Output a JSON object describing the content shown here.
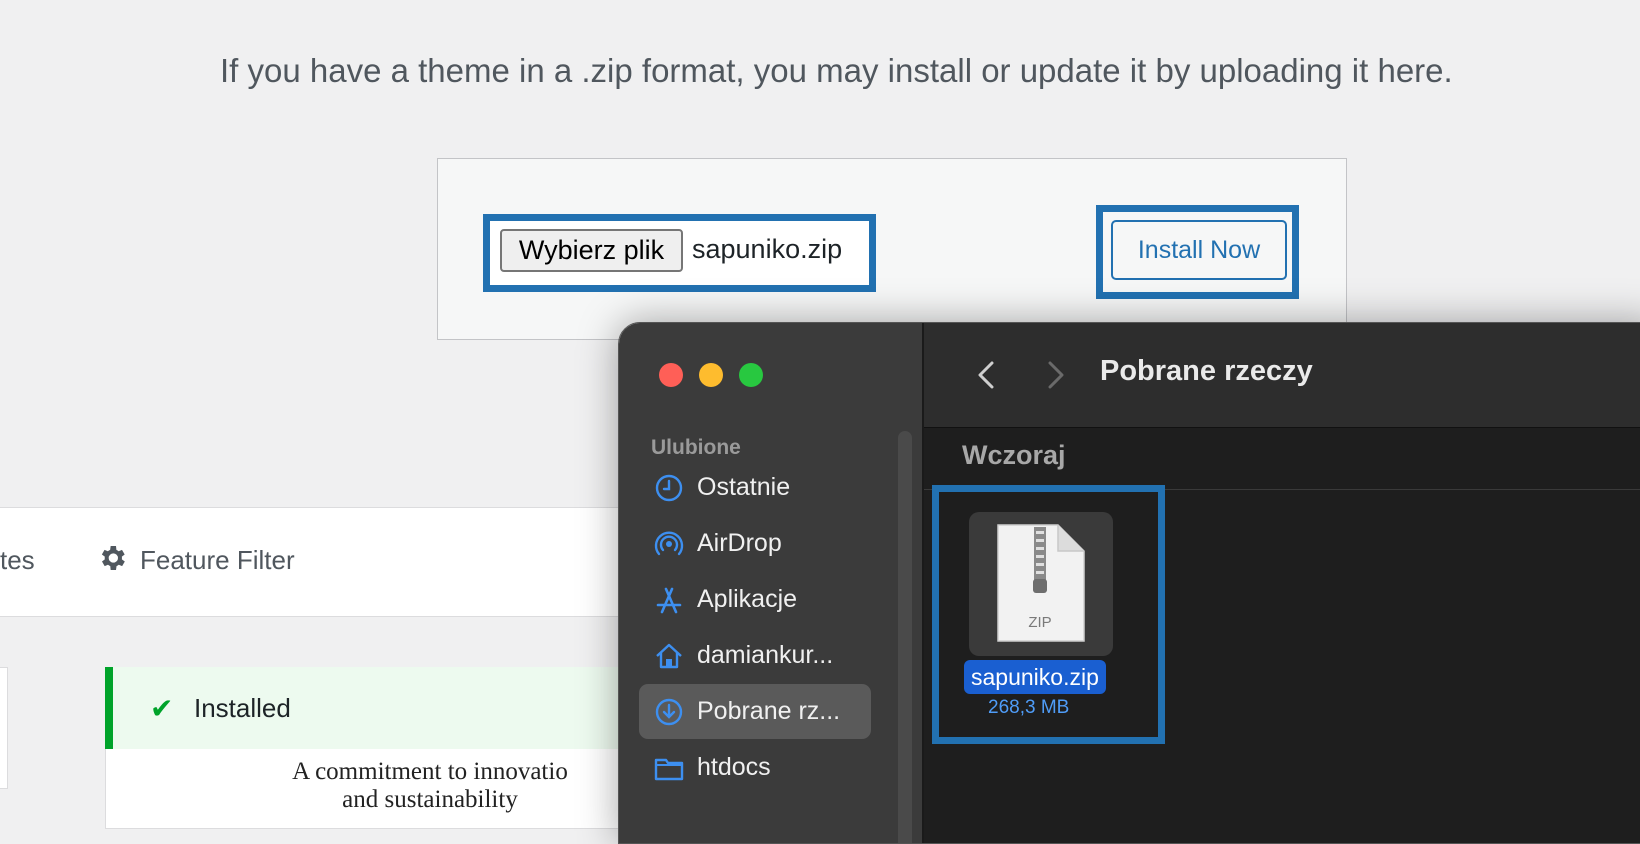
{
  "intro_text": "If you have a theme in a .zip format, you may install or update it by uploading it here.",
  "upload": {
    "choose_button": "Wybierz plik",
    "file_name": "sapuniko.zip",
    "install_button": "Install Now"
  },
  "filter_bar": {
    "partial_tab": "tes",
    "feature_filter": "Feature Filter",
    "gear_icon": "gear-icon"
  },
  "theme_card": {
    "status": "Installed",
    "description_line1": "A commitment to innovatio",
    "description_line2": "and sustainability"
  },
  "finder": {
    "title": "Pobrane rzeczy",
    "sidebar_section": "Ulubione",
    "sidebar_items": [
      {
        "label": "Ostatnie",
        "icon": "clock-icon"
      },
      {
        "label": "AirDrop",
        "icon": "airdrop-icon"
      },
      {
        "label": "Aplikacje",
        "icon": "applications-icon"
      },
      {
        "label": "damiankur...",
        "icon": "home-icon"
      },
      {
        "label": "Pobrane rz...",
        "icon": "download-icon",
        "selected": true
      },
      {
        "label": "htdocs",
        "icon": "folder-icon"
      }
    ],
    "group_label": "Wczoraj",
    "file": {
      "name": "sapuniko.zip",
      "size": "268,3 MB",
      "type_label": "ZIP"
    }
  },
  "colors": {
    "wp_blue": "#2271b1",
    "installed_green": "#00a32a",
    "finder_selection": "#1a5fd1"
  }
}
